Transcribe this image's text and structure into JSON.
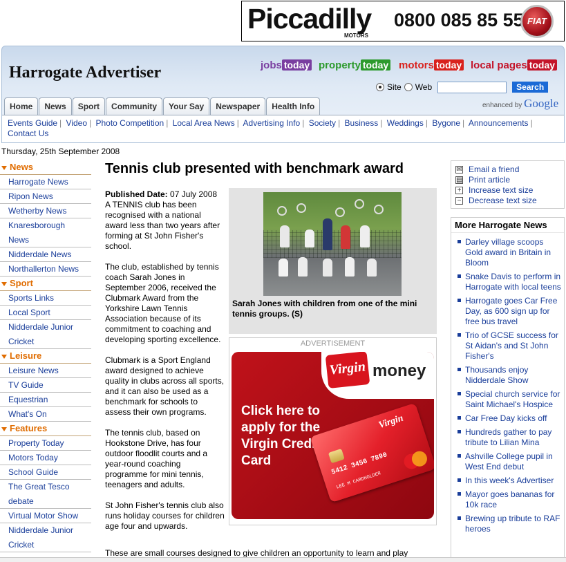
{
  "top_ad": {
    "brand": "Piccadilly",
    "sub": "MOTORS",
    "phone": "0800 085 85 55",
    "badge": "FIAT"
  },
  "site": {
    "title": "Harrogate Advertiser"
  },
  "logos": [
    {
      "prefix": "jobs",
      "tag": "today",
      "color": "#7a3ea0"
    },
    {
      "prefix": "property",
      "tag": "today",
      "color": "#2d9a2d"
    },
    {
      "prefix": "motors",
      "tag": "today",
      "color": "#d9221e"
    },
    {
      "prefix": "local pages",
      "tag": "today",
      "color": "#c4142a"
    }
  ],
  "search": {
    "site_label": "Site",
    "web_label": "Web",
    "button": "Search",
    "value": "",
    "enhanced": "enhanced by",
    "google": "Google"
  },
  "tabs": [
    "Home",
    "News",
    "Sport",
    "Community",
    "Your Say",
    "Newspaper",
    "Health Info"
  ],
  "subnav": [
    "Events Guide",
    "Video",
    "Photo Competition",
    "Local Area News",
    "Advertising Info",
    "Society",
    "Business",
    "Weddings",
    "Bygone",
    "Announcements",
    "Contact Us"
  ],
  "date": "Thursday, 25th September 2008",
  "leftnav": {
    "news": {
      "title": "News",
      "items": [
        "Harrogate News",
        "Ripon News",
        "Wetherby News",
        "Knaresborough",
        "News",
        "Nidderdale News",
        "Northallerton News"
      ]
    },
    "sport": {
      "title": "Sport",
      "items": [
        "Sports Links",
        "Local Sport",
        "Nidderdale Junior",
        "Cricket"
      ]
    },
    "leisure": {
      "title": "Leisure",
      "items": [
        "Leisure News",
        "TV Guide",
        "Equestrian",
        "What's On"
      ]
    },
    "features": {
      "title": "Features",
      "items": [
        "Property Today",
        "Motors Today",
        "School Guide",
        "The Great Tesco",
        "debate",
        "Virtual Motor Show",
        "Nidderdale Junior",
        "Cricket"
      ]
    }
  },
  "article": {
    "headline": "Tennis club presented with benchmark award",
    "published_label": "Published Date:",
    "published_date": "07 July 2008",
    "p1": "A TENNIS club has been recognised with a national award less than two years after forming at St John Fisher's school.",
    "p2": "The club, established by tennis coach Sarah Jones in September 2006, received the Clubmark Award from the Yorkshire Lawn Tennis Association because of its commitment to coaching and developing sporting excellence.",
    "p3": "Clubmark is a Sport England award designed to achieve quality in clubs across all sports, and it can also be used as a benchmark for schools to assess their own programs.",
    "p4": "The tennis club, based on Hookstone Drive, has four outdoor floodlit courts and a year-round coaching programme for mini tennis, teenagers and adults.",
    "p5": "St John Fisher's tennis club also runs holiday courses for children age four and upwards.",
    "p6": "These are small courses designed to give children an opportunity to learn and play",
    "caption": "Sarah Jones with children from one of the mini tennis groups. (S)"
  },
  "ad": {
    "label": "ADVERTISEMENT",
    "logo": "Virgin",
    "money": "money",
    "cta": "Click here to apply for the Virgin Credit Card",
    "card_num": "5412 3456 7890",
    "card_name": "LEE M CARDHOLDER",
    "card_brand": "Virgin"
  },
  "tools": [
    "Email a friend",
    "Print article",
    "Increase text size",
    "Decrease text size"
  ],
  "more": {
    "title": "More Harrogate News",
    "items": [
      "Darley village scoops Gold award in Britain in Bloom",
      "Snake Davis to perform in Harrogate with local teens",
      "Harrogate goes Car Free Day, as 600 sign up for free bus travel",
      "Trio of GCSE success for St Aidan's and St John Fisher's",
      "Thousands enjoy Nidderdale Show",
      "Special church service for Saint Michael's Hospice",
      "Car Free Day kicks off",
      "Hundreds gather to pay tribute to Lilian Mina",
      "Ashville College pupil in West End debut",
      "In this week's Advertiser",
      "Mayor goes bananas for 10k race",
      "Brewing up tribute to RAF heroes"
    ]
  }
}
